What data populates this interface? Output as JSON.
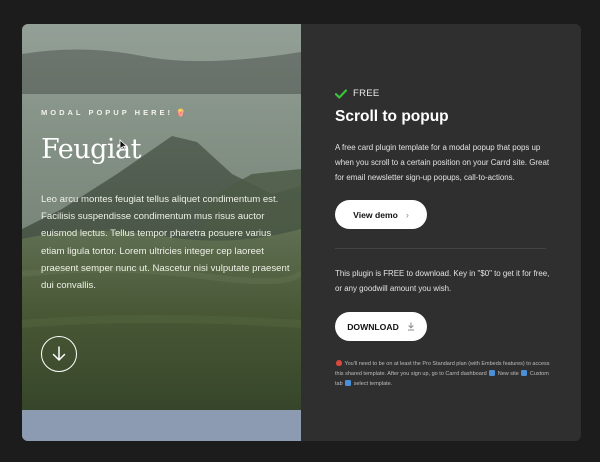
{
  "hero": {
    "eyebrow": "MODAL POPUP HERE!",
    "eyebrow_emoji": "🍿",
    "heading": "Feugiat",
    "body": "Leo arcu montes feugiat tellus aliquet condimentum est. Facilisis suspendisse condimentum mus risus auctor euismod lectus. Tellus tempor pharetra posuere varius etiam ligula tortor. Lorem ultricies integer cep laoreet praesent semper nunc ut. Nascetur nisi vulputate praesent dui convallis.",
    "scroll_icon": "arrow-down-circle-icon"
  },
  "plugin": {
    "badge": "FREE",
    "badge_icon": "check-icon",
    "badge_color": "#3ec13a",
    "title": "Scroll to popup",
    "description": "A free card plugin template for a modal popup that pops up when you scroll to a certain position on your Carrd site. Great for email newsletter sign-up popups, call-to-actions.",
    "demo_label": "View demo",
    "demo_icon": "chevron-right-icon",
    "free_note": "This plugin is FREE to download. Key in \"$0\" to get it for free, or any goodwill amount you wish.",
    "download_label": "DOWNLOAD",
    "download_icon": "download-icon",
    "fine_print": {
      "part1": "You'll need to be on at least the Pro Standard plan (with Embeds features) to access this shared template. After you sign up, go to Carrd dashboard",
      "part2": "New site",
      "part3": "Custom tab",
      "part4": "select template."
    }
  },
  "colors": {
    "page_bg": "#1c1c1d",
    "panel_bg": "#2f2f30",
    "button_bg": "#ffffff",
    "strip": "#8d9bb2"
  }
}
